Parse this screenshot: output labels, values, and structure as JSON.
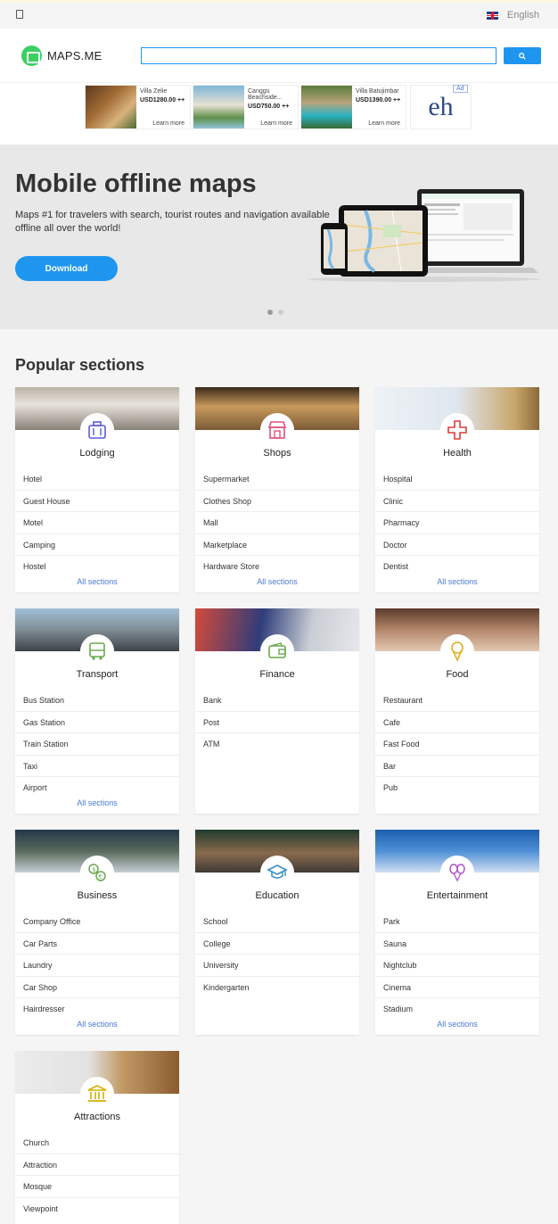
{
  "topbar": {
    "language": "English"
  },
  "header": {
    "logo_text": "MAPS.ME",
    "search_value": ""
  },
  "ads": [
    {
      "name": "Villa Zelie",
      "price": "USD1280.00 ++",
      "cta": "Learn more"
    },
    {
      "name": "Canggu Beachside...",
      "price": "USD750.00 ++",
      "cta": "Learn more"
    },
    {
      "name": "Villa Batujimbar",
      "price": "USD1390.00 ++",
      "cta": "Learn more"
    }
  ],
  "ad_logo": "eh",
  "ad_badge": "Ad",
  "hero": {
    "title": "Mobile offline maps",
    "subtitle": "Maps #1 for travelers with search, tourist routes and navigation available offline all over the world!",
    "download_label": "Download"
  },
  "popular": {
    "heading": "Popular sections",
    "all_label": "All sections",
    "sections": [
      {
        "title": "Lodging",
        "icon": "suitcase-icon",
        "items": [
          "Hotel",
          "Guest House",
          "Motel",
          "Camping",
          "Hostel"
        ],
        "has_all": true
      },
      {
        "title": "Shops",
        "icon": "shop-icon",
        "items": [
          "Supermarket",
          "Clothes Shop",
          "Mall",
          "Marketplace",
          "Hardware Store"
        ],
        "has_all": true
      },
      {
        "title": "Health",
        "icon": "medical-cross-icon",
        "items": [
          "Hospital",
          "Clinic",
          "Pharmacy",
          "Doctor",
          "Dentist"
        ],
        "has_all": true
      },
      {
        "title": "Transport",
        "icon": "bus-icon",
        "items": [
          "Bus Station",
          "Gas Station",
          "Train Station",
          "Taxi",
          "Airport"
        ],
        "has_all": true
      },
      {
        "title": "Finance",
        "icon": "wallet-icon",
        "items": [
          "Bank",
          "Post",
          "ATM"
        ],
        "has_all": false
      },
      {
        "title": "Food",
        "icon": "ice-cream-icon",
        "items": [
          "Restaurant",
          "Cafe",
          "Fast Food",
          "Bar",
          "Pub"
        ],
        "has_all": false
      },
      {
        "title": "Business",
        "icon": "currency-exchange-icon",
        "items": [
          "Company Office",
          "Car Parts",
          "Laundry",
          "Car Shop",
          "Hairdresser"
        ],
        "has_all": true
      },
      {
        "title": "Education",
        "icon": "graduation-cap-icon",
        "items": [
          "School",
          "College",
          "University",
          "Kindergarten"
        ],
        "has_all": false
      },
      {
        "title": "Entertainment",
        "icon": "balloons-icon",
        "items": [
          "Park",
          "Sauna",
          "Nightclub",
          "Cinema",
          "Stadium"
        ],
        "has_all": true
      },
      {
        "title": "Attractions",
        "icon": "museum-icon",
        "items": [
          "Church",
          "Attraction",
          "Mosque",
          "Viewpoint"
        ],
        "has_all": false
      }
    ]
  },
  "colors": {
    "accent": "#1e96f0",
    "brand": "#3ccf62",
    "link": "#4a7ad6"
  }
}
